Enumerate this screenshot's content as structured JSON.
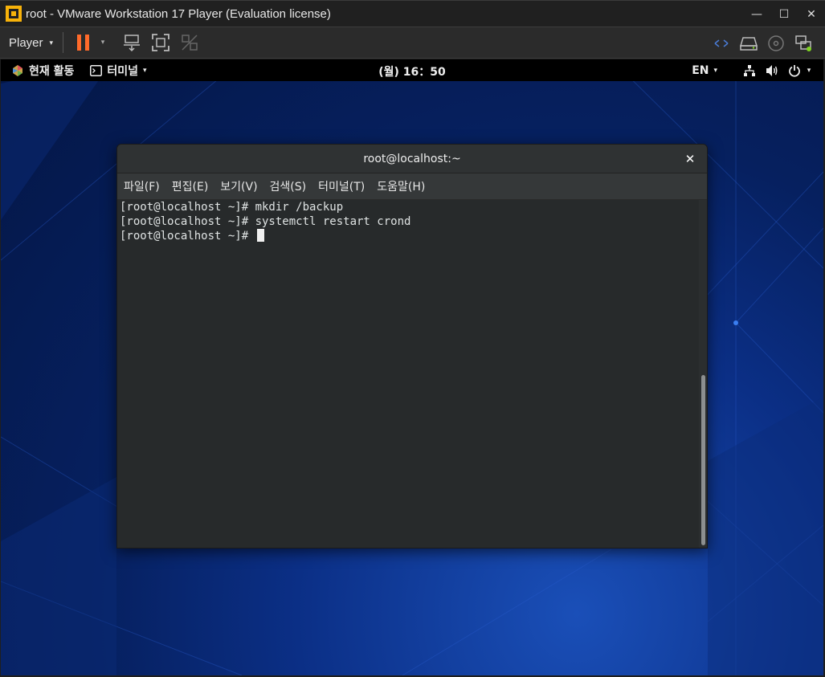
{
  "vm_window": {
    "title": "root - VMware Workstation 17 Player (Evaluation license)",
    "controls": {
      "minimize": "—",
      "maximize": "☐",
      "close": "✕"
    }
  },
  "toolbar": {
    "player_menu": "Player",
    "caret": "▾",
    "colors": {
      "pause": "#ff6a2a",
      "status_green": "#7ed321"
    }
  },
  "gnome_bar": {
    "activities": "현재 활동",
    "app_menu": "터미널",
    "caret": "▾",
    "clock": "(월) 16：50",
    "language": "EN"
  },
  "terminal": {
    "title": "root@localhost:~",
    "close": "✕",
    "menu": [
      "파일(F)",
      "편집(E)",
      "보기(V)",
      "검색(S)",
      "터미널(T)",
      "도움말(H)"
    ],
    "lines": [
      "[root@localhost ~]# mkdir /backup",
      "[root@localhost ~]# systemctl restart crond",
      "[root@localhost ~]# "
    ]
  }
}
